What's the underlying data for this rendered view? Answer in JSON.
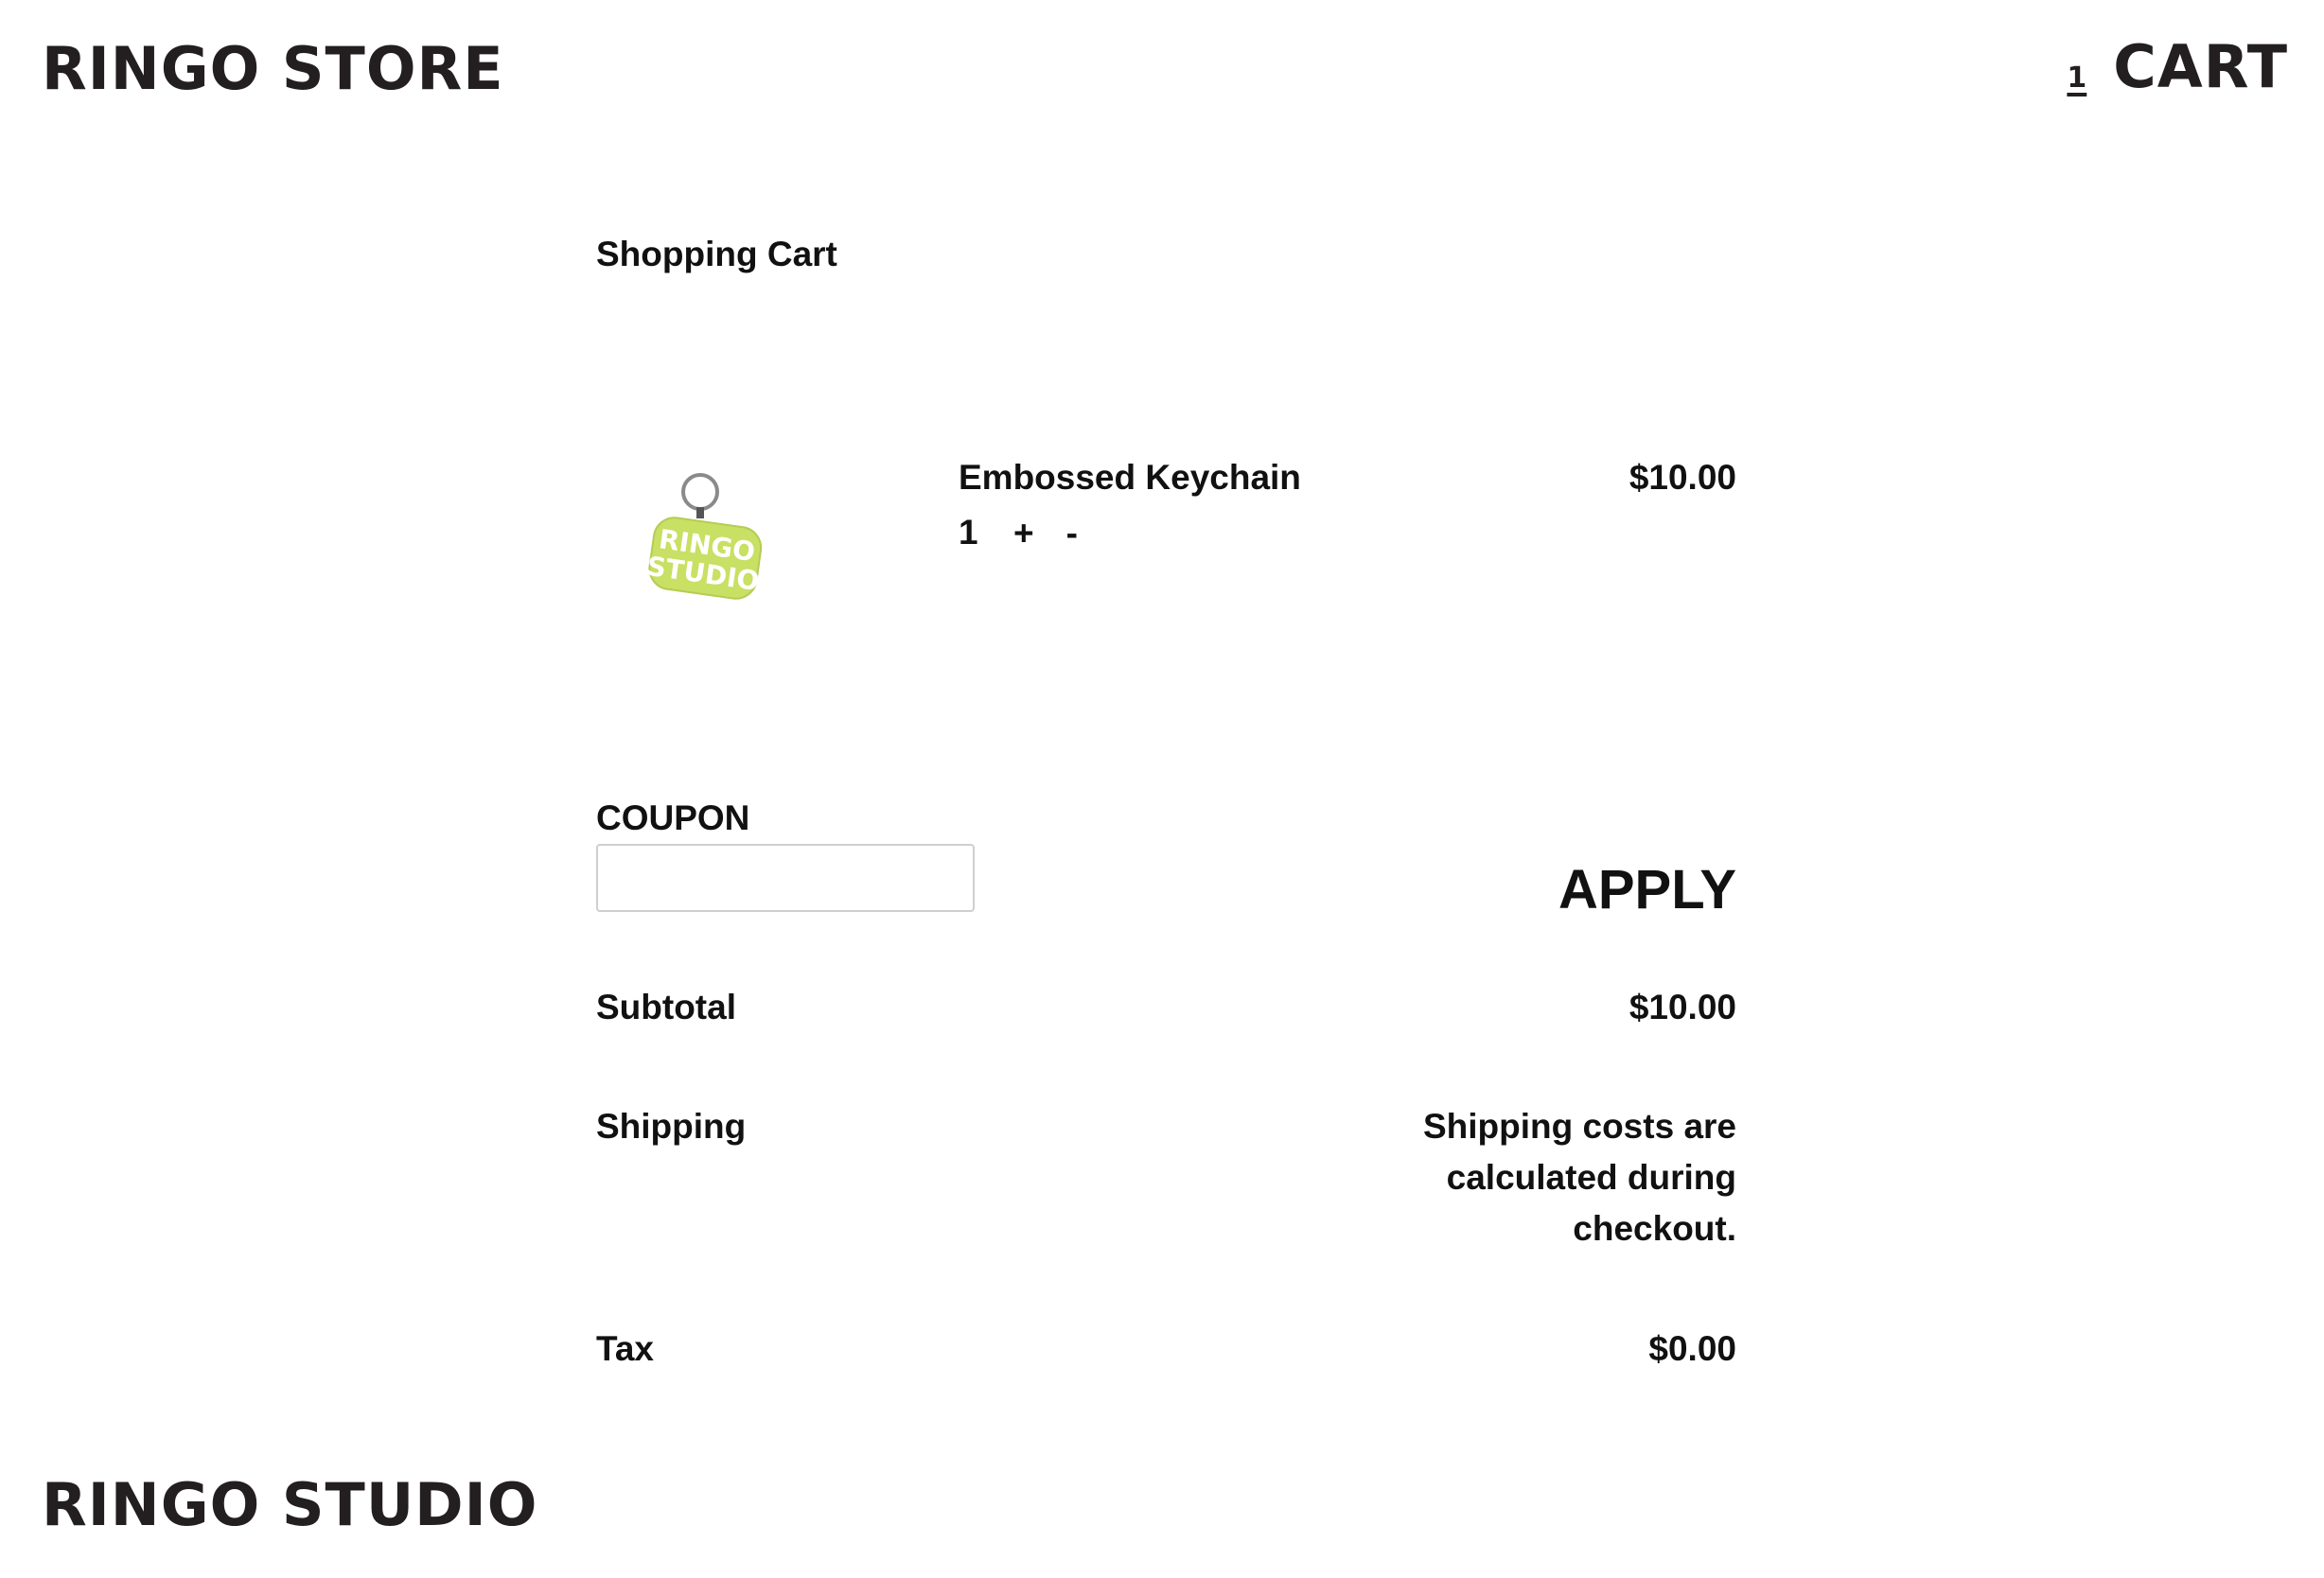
{
  "header": {
    "brand": "RINGO STORE",
    "cart_count": "1",
    "cart_label": "CART"
  },
  "cart": {
    "title": "Shopping Cart",
    "items": [
      {
        "name": "Embossed Keychain",
        "price": "$10.00",
        "quantity": "1",
        "increment_label": "+",
        "decrement_label": "-",
        "image_text_line1": "RINGO",
        "image_text_line2": "STUDIO",
        "image_color": "#c8e063"
      }
    ]
  },
  "coupon": {
    "label": "COUPON",
    "value": "",
    "apply_label": "APPLY"
  },
  "summary": {
    "subtotal_label": "Subtotal",
    "subtotal_value": "$10.00",
    "shipping_label": "Shipping",
    "shipping_value": "Shipping costs are calculated during checkout.",
    "tax_label": "Tax",
    "tax_value": "$0.00"
  },
  "footer": {
    "brand": "RINGO STUDIO"
  }
}
